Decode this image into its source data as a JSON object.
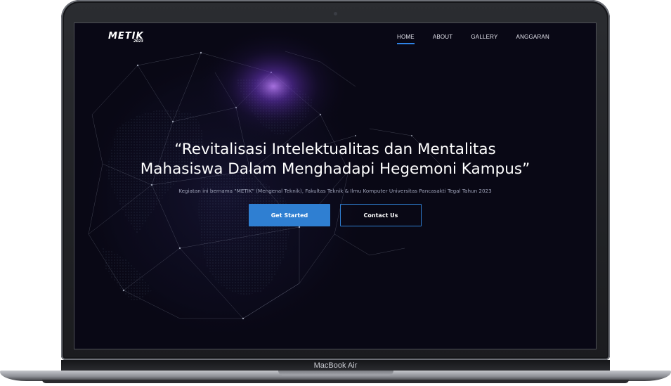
{
  "device": {
    "label": "MacBook Air"
  },
  "site": {
    "logo": "METIK",
    "logo_year": "2023",
    "nav": [
      {
        "label": "HOME",
        "active": true
      },
      {
        "label": "ABOUT",
        "active": false
      },
      {
        "label": "GALLERY",
        "active": false
      },
      {
        "label": "ANGGARAN",
        "active": false
      }
    ],
    "hero": {
      "headline_line1": "“Revitalisasi Intelektualitas dan Mentalitas",
      "headline_line2": "Mahasiswa Dalam Menghadapi Hegemoni Kampus”",
      "subtitle": "Kegiatan ini bernama \"METIK\" (Mengenal Teknik), Fakultas Teknik & Ilmu Komputer Universitas Pancasakti Tegal Tahun 2023",
      "primary_button": "Get Started",
      "secondary_button": "Contact Us"
    }
  },
  "colors": {
    "accent": "#2f7fd2",
    "background": "#090815",
    "glow": "#7a3fd0"
  }
}
